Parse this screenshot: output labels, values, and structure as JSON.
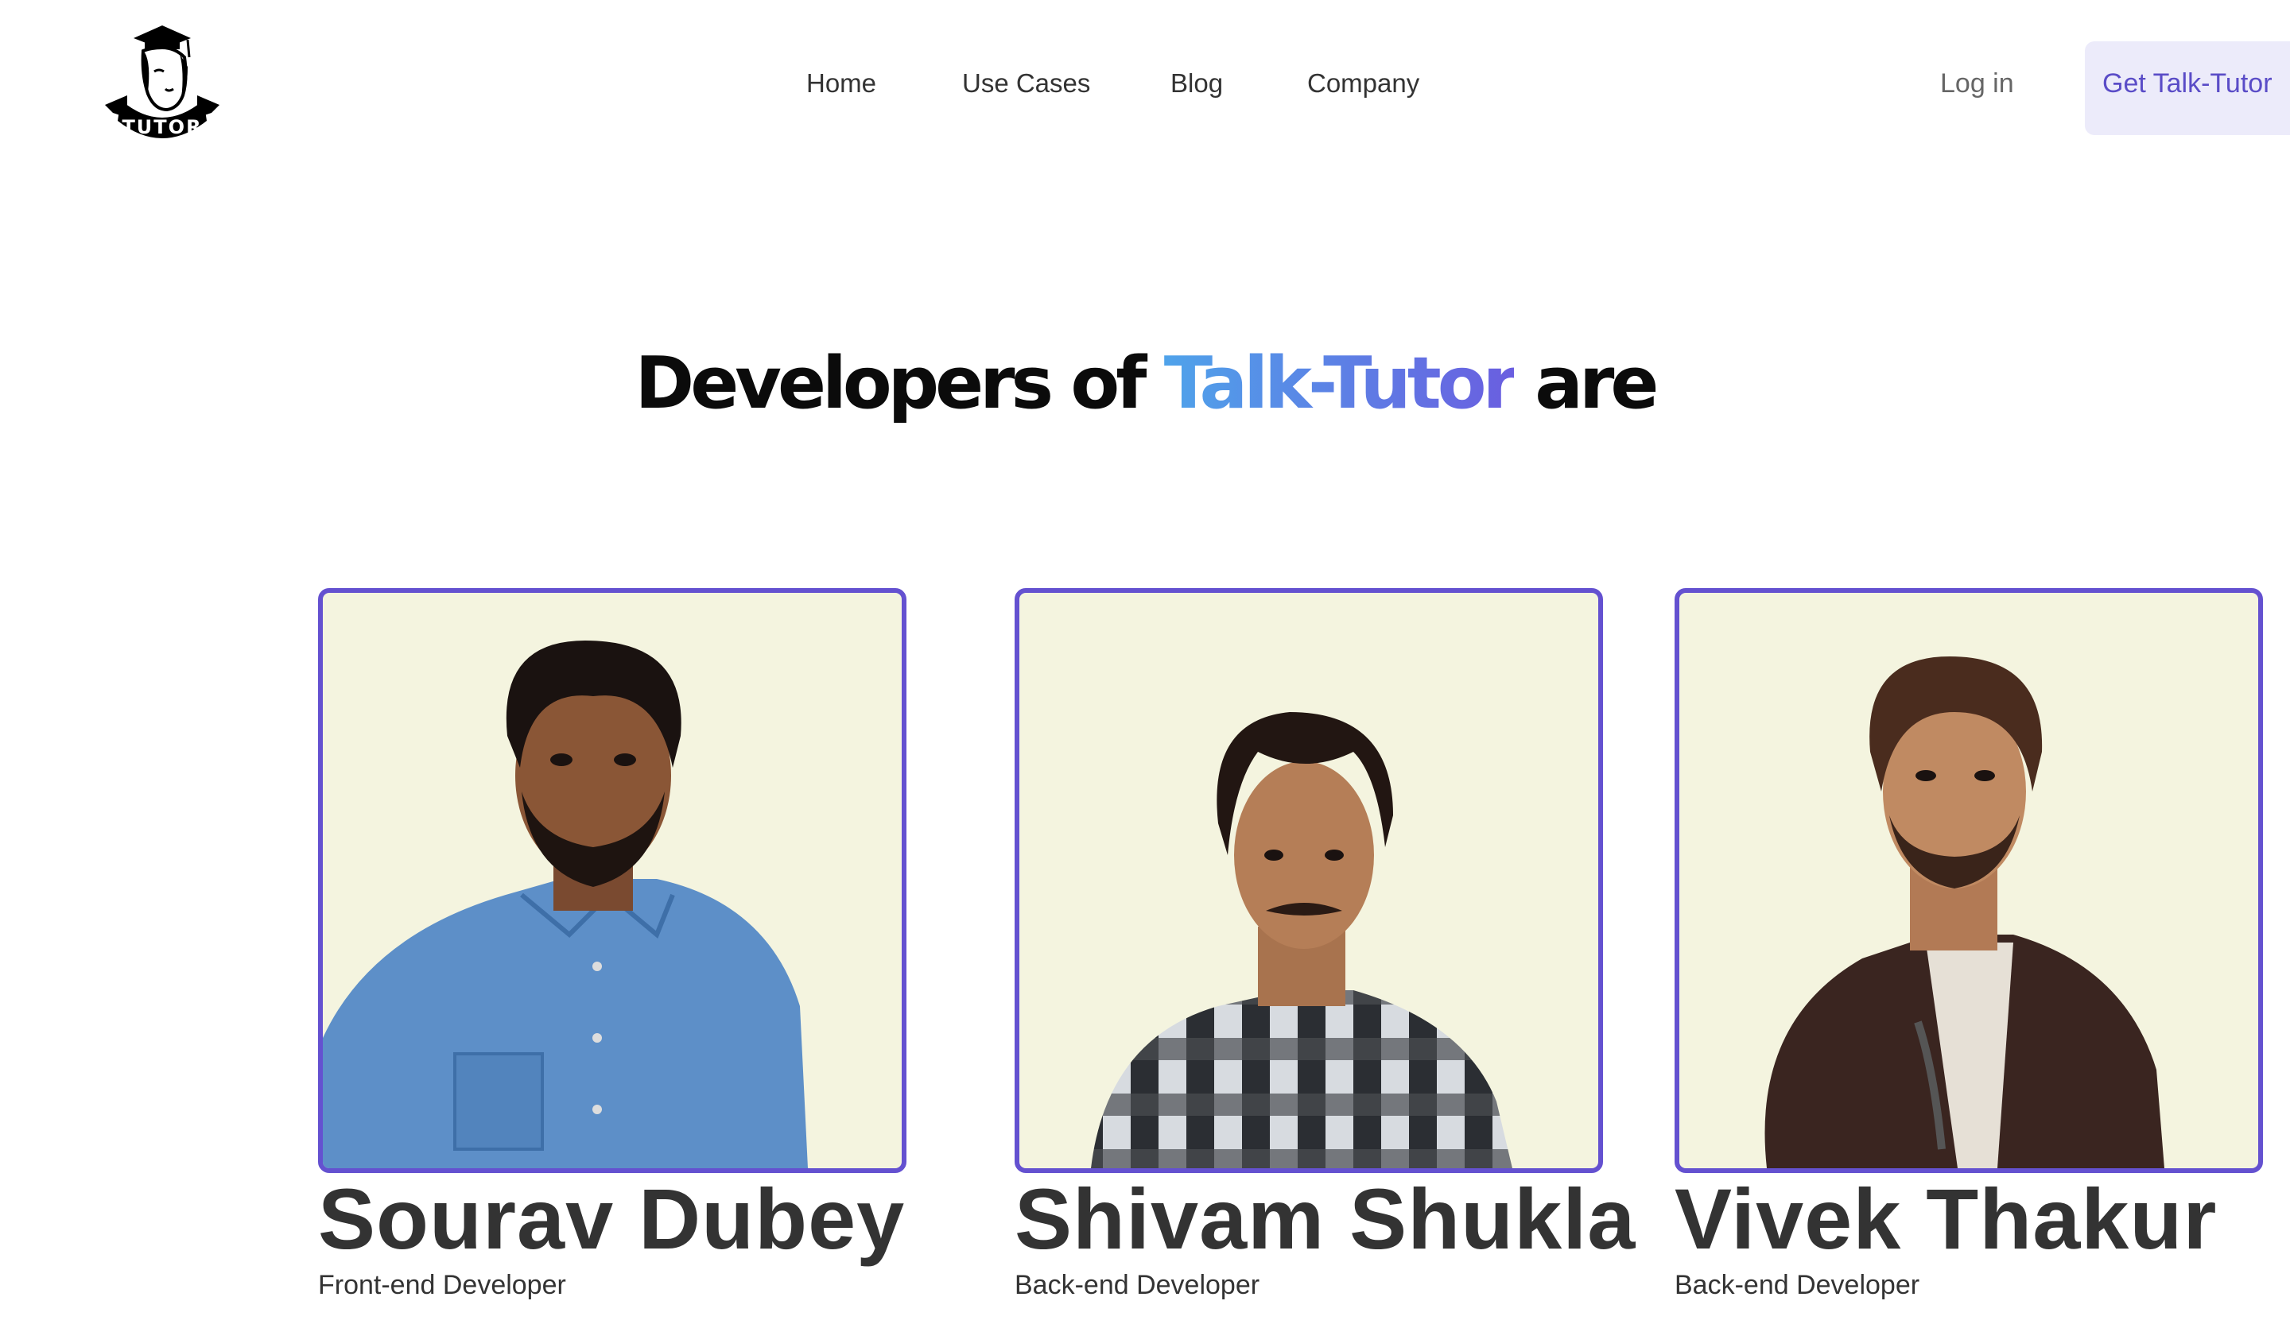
{
  "header": {
    "logo_text": "TUTOR",
    "nav": [
      "Home",
      "Use Cases",
      "Blog",
      "Company"
    ],
    "login_label": "Log in",
    "cta_label": "Get Talk-Tutor"
  },
  "heading": {
    "prefix": "Developers of ",
    "brand": "Talk-Tutor",
    "suffix": " are"
  },
  "developers": [
    {
      "name": "Sourav Dubey",
      "role": "Front-end Developer",
      "shirt": "blue denim shirt"
    },
    {
      "name": "Shivam Shukla",
      "role": "Back-end Developer",
      "shirt": "checkered shirt"
    },
    {
      "name": "Vivek Thakur",
      "role": "Back-end Developer",
      "shirt": "brown jacket"
    }
  ],
  "colors": {
    "accent": "#6451d0",
    "cta_bg": "#ecebfa",
    "cta_text": "#5a4cc7",
    "photo_bg": "#f4f4df",
    "brand_gradient_start": "#4fa3ea",
    "brand_gradient_end": "#6a5ee0"
  }
}
